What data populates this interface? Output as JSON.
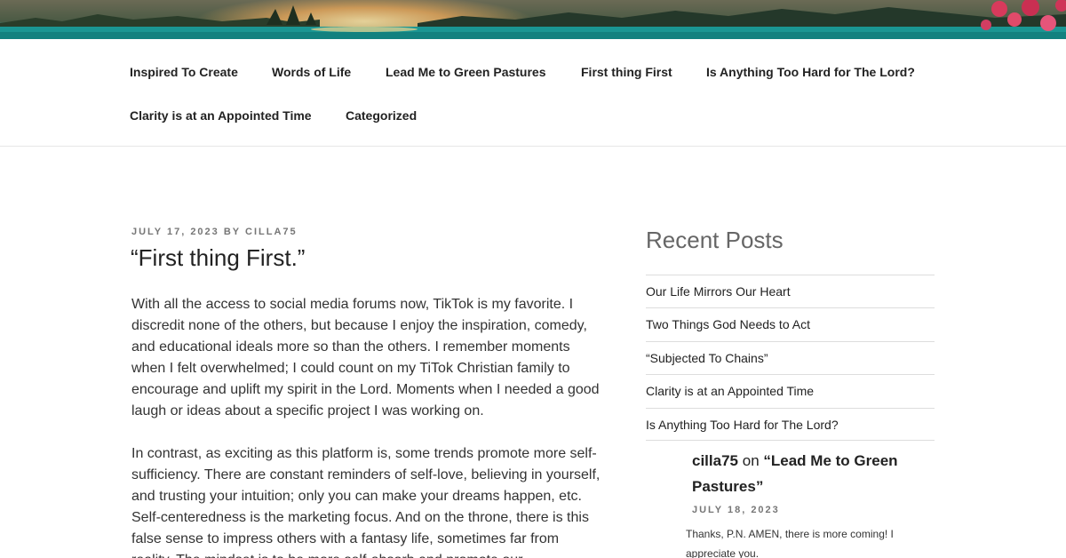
{
  "colors": {
    "text_dark": "#222222",
    "text_meta": "#767676",
    "widget_title": "#666666",
    "divider": "#dddddd",
    "header_water": "#18a3a0"
  },
  "nav": {
    "items": [
      {
        "label": "Inspired To Create"
      },
      {
        "label": "Words of Life"
      },
      {
        "label": "Lead Me to Green Pastures"
      },
      {
        "label": "First thing First"
      },
      {
        "label": "Is Anything Too Hard for The Lord?"
      },
      {
        "label": "Clarity is at an Appointed Time"
      },
      {
        "label": "Categorized"
      }
    ]
  },
  "post": {
    "date": "JULY 17, 2023",
    "by": "BY",
    "author": "CILLA75",
    "title": "“First thing First.”",
    "paragraphs": [
      "With all the access to social media forums now, TikTok is my favorite. I discredit none of the others, but because I enjoy the inspiration, comedy, and educational ideals more so than the others. I remember moments when I felt overwhelmed; I could count on my TiTok Christian family to encourage and uplift my spirit in the Lord. Moments when I needed a good laugh or ideas about a specific project I was working on.",
      "In contrast, as exciting as this platform is, some trends promote more self-sufficiency. There are constant reminders of self-love, believing in yourself, and trusting your intuition; only you can make your dreams happen, etc. Self-centeredness is the marketing focus. And on the throne, there is this false sense to impress others with a fantasy life, sometimes far from reality. The mindset is to be more self-absorb and promote our"
    ]
  },
  "sidebar": {
    "recent_title": "Recent Posts",
    "recent_posts": [
      {
        "label": "Our Life Mirrors Our Heart"
      },
      {
        "label": "Two Things God Needs to Act"
      },
      {
        "label": "“Subjected To Chains”"
      },
      {
        "label": "Clarity is at an Appointed Time"
      },
      {
        "label": "Is Anything Too Hard for The Lord?"
      }
    ],
    "comment": {
      "author": "cilla75",
      "on": "on",
      "post": "“Lead Me to Green Pastures”",
      "date": "JULY 18, 2023",
      "text": "Thanks, P.N. AMEN, there is more coming! I appreciate you."
    }
  }
}
